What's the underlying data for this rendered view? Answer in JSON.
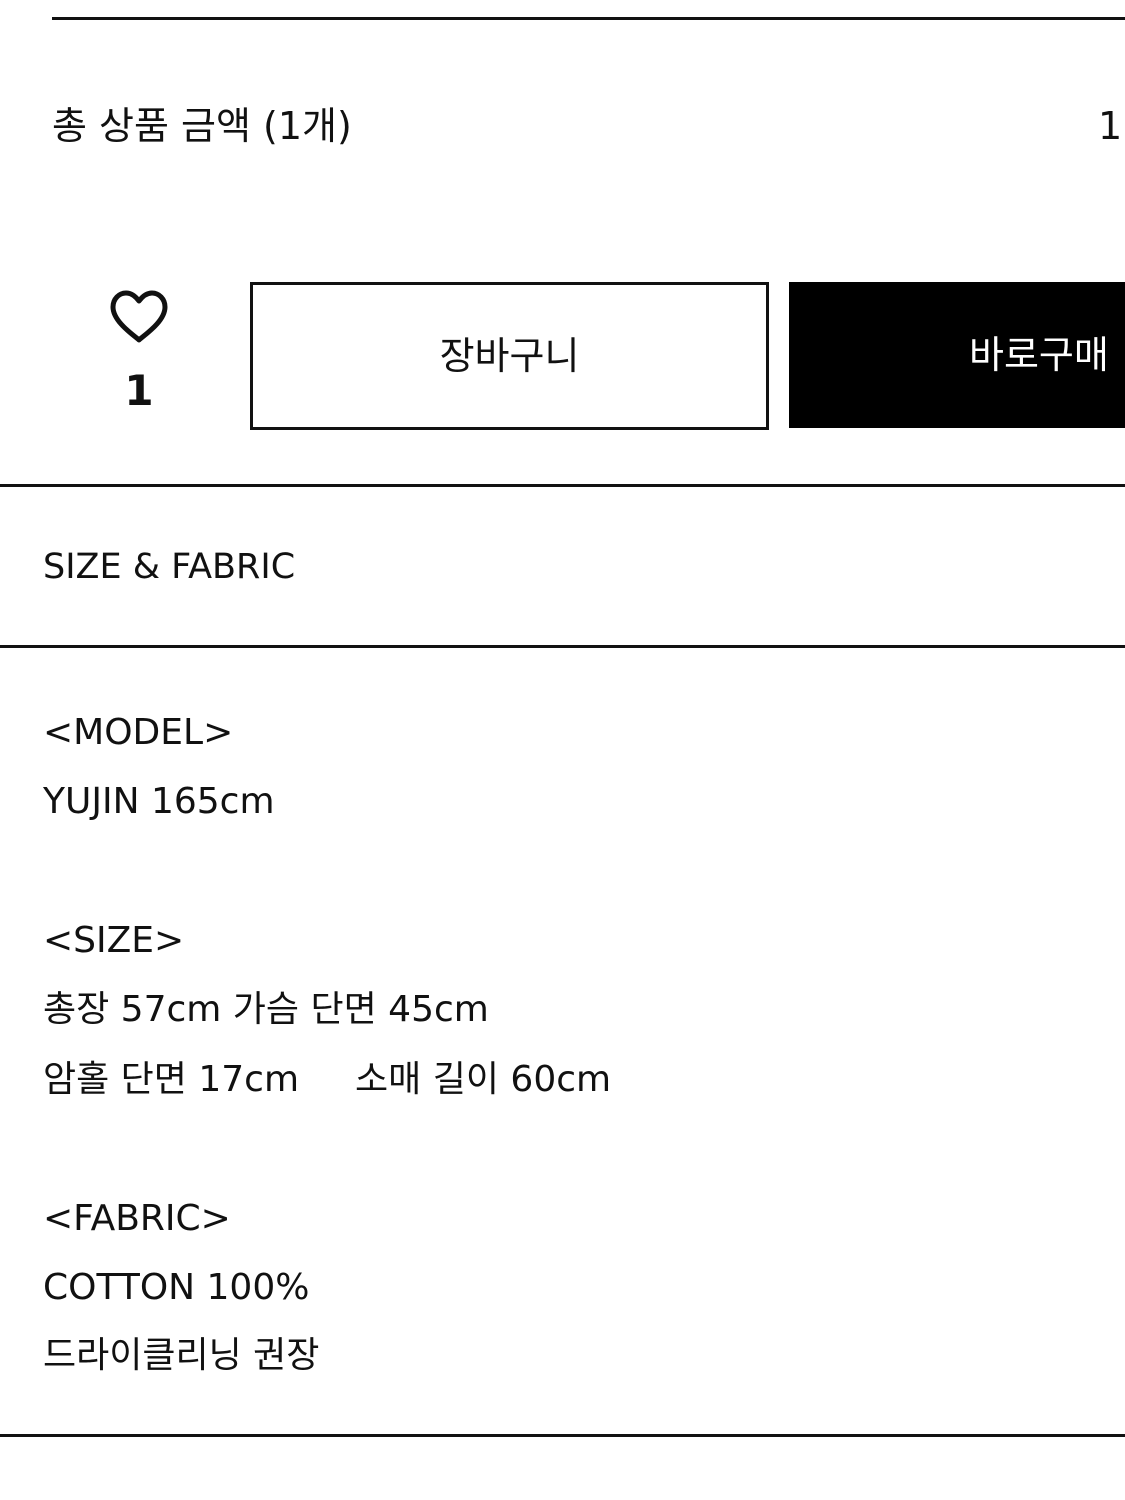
{
  "summary": {
    "total_label": "총 상품 금액 (1개)",
    "total_price_partial": "1:"
  },
  "actions": {
    "wish_count": "1",
    "cart_label": "장바구니",
    "buy_label": "바로구매"
  },
  "section": {
    "title": "SIZE & FABRIC"
  },
  "details": {
    "model_heading": "<MODEL>",
    "model_value": "YUJIN 165cm",
    "size_heading": "<SIZE>",
    "size_line1": "총장 57cm 가슴 단면 45cm",
    "size_line2_a": "암홀 단면 17cm",
    "size_line2_b": "소매 길이 60cm",
    "fabric_heading": "<FABRIC>",
    "fabric_value": "COTTON 100%",
    "care_note": "드라이클리닝 권장"
  },
  "icons": {
    "wish": "heart-outline-icon"
  },
  "colors": {
    "text": "#111111",
    "buy_button_bg": "#000000",
    "buy_button_text": "#ffffff",
    "background": "#ffffff"
  }
}
